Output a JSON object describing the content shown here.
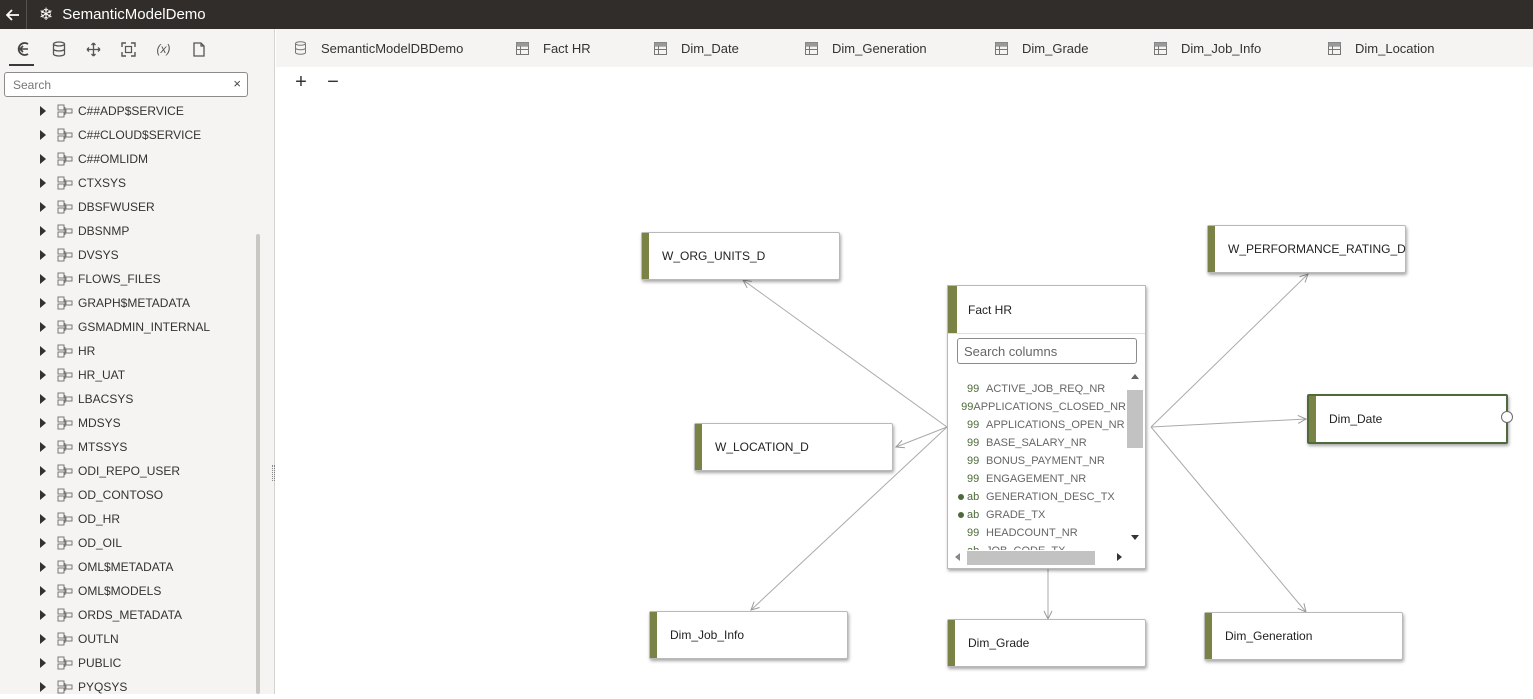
{
  "app": {
    "title": "SemanticModelDemo"
  },
  "left_panel": {
    "tools": [
      "back-arrow-icon",
      "database-icon",
      "move-icon",
      "fit-screen-icon",
      "variable-icon",
      "document-icon"
    ],
    "variable_label": "(x)",
    "search": {
      "placeholder": "Search",
      "value": ""
    },
    "tree": [
      {
        "label": "C##ADP$SERVICE"
      },
      {
        "label": "C##CLOUD$SERVICE"
      },
      {
        "label": "C##OMLIDM"
      },
      {
        "label": "CTXSYS"
      },
      {
        "label": "DBSFWUSER"
      },
      {
        "label": "DBSNMP"
      },
      {
        "label": "DVSYS"
      },
      {
        "label": "FLOWS_FILES"
      },
      {
        "label": "GRAPH$METADATA"
      },
      {
        "label": "GSMADMIN_INTERNAL"
      },
      {
        "label": "HR"
      },
      {
        "label": "HR_UAT"
      },
      {
        "label": "LBACSYS"
      },
      {
        "label": "MDSYS"
      },
      {
        "label": "MTSSYS"
      },
      {
        "label": "ODI_REPO_USER"
      },
      {
        "label": "OD_CONTOSO"
      },
      {
        "label": "OD_HR"
      },
      {
        "label": "OD_OIL"
      },
      {
        "label": "OML$METADATA"
      },
      {
        "label": "OML$MODELS"
      },
      {
        "label": "ORDS_METADATA"
      },
      {
        "label": "OUTLN"
      },
      {
        "label": "PUBLIC"
      },
      {
        "label": "PYQSYS"
      }
    ]
  },
  "tabs": [
    {
      "label": "SemanticModelDBDemo",
      "icon": "database-icon"
    },
    {
      "label": "Fact HR",
      "icon": "table-icon"
    },
    {
      "label": "Dim_Date",
      "icon": "table-icon"
    },
    {
      "label": "Dim_Generation",
      "icon": "table-icon"
    },
    {
      "label": "Dim_Grade",
      "icon": "table-icon"
    },
    {
      "label": "Dim_Job_Info",
      "icon": "table-icon"
    },
    {
      "label": "Dim_Location",
      "icon": "table-icon"
    }
  ],
  "canvas": {
    "zoom_in": "+",
    "zoom_out": "−",
    "nodes": {
      "org_units": "W_ORG_UNITS_D",
      "perf_rating": "W_PERFORMANCE_RATING_D",
      "location": "W_LOCATION_D",
      "dim_date": "Dim_Date",
      "dim_job_info": "Dim_Job_Info",
      "dim_grade": "Dim_Grade",
      "dim_generation": "Dim_Generation"
    },
    "fact": {
      "title": "Fact HR",
      "search_placeholder": "Search columns",
      "columns": [
        {
          "type": "99",
          "name": "ACTIVE_JOB_REQ_NR",
          "dot": false
        },
        {
          "type": "99",
          "name": "APPLICATIONS_CLOSED_NR",
          "dot": false
        },
        {
          "type": "99",
          "name": "APPLICATIONS_OPEN_NR",
          "dot": false
        },
        {
          "type": "99",
          "name": "BASE_SALARY_NR",
          "dot": false
        },
        {
          "type": "99",
          "name": "BONUS_PAYMENT_NR",
          "dot": false
        },
        {
          "type": "99",
          "name": "ENGAGEMENT_NR",
          "dot": false
        },
        {
          "type": "ab",
          "name": "GENERATION_DESC_TX",
          "dot": true
        },
        {
          "type": "ab",
          "name": "GRADE_TX",
          "dot": true
        },
        {
          "type": "99",
          "name": "HEADCOUNT_NR",
          "dot": false
        },
        {
          "type": "ab",
          "name": "JOB_CODE_TX",
          "dot": false
        }
      ]
    }
  },
  "colors": {
    "titlebar": "#312d2a",
    "accent": "#7a8245",
    "selected_border": "#4e6a3a"
  }
}
